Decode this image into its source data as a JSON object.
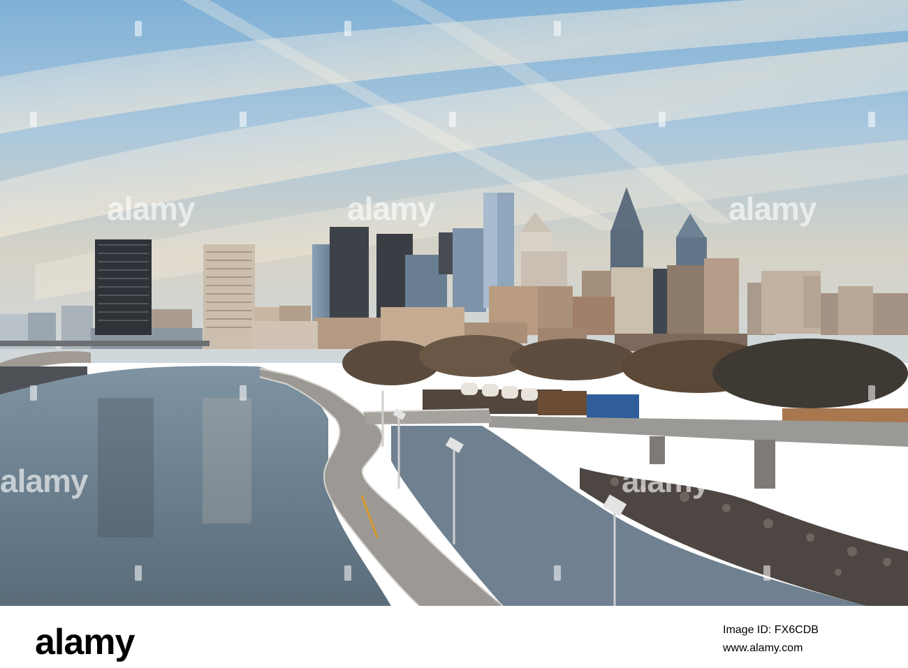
{
  "photo": {
    "subject": "philadelphia-skyline-schuylkill-river-boardwalk",
    "colors": {
      "sky_top": "#8fb8da",
      "sky_mid": "#c9d3d8",
      "water": "#6f8191",
      "boardwalk": "#9a9591"
    }
  },
  "watermarks": {
    "text": "alamy"
  },
  "footer": {
    "logo": "alamy",
    "image_id_label": "Image ID: FX6CDB",
    "site": "www.alamy.com"
  }
}
